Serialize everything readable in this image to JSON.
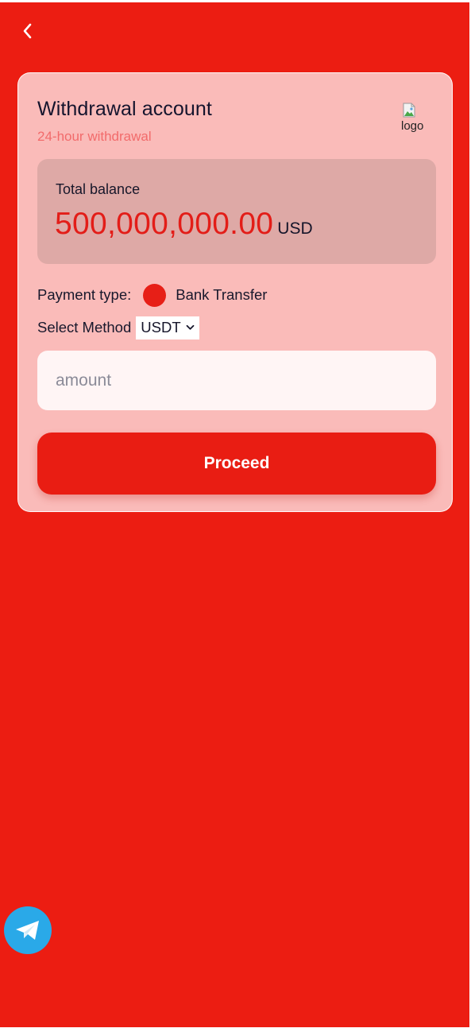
{
  "header": {
    "back_icon": "chevron-left-icon"
  },
  "card": {
    "title": "Withdrawal account",
    "subtitle": "24-hour withdrawal",
    "logo_alt": "logo"
  },
  "balance": {
    "label": "Total balance",
    "value": "500,000,000.00",
    "currency": "USD"
  },
  "payment": {
    "label": "Payment type:",
    "option": "Bank Transfer",
    "selected": true
  },
  "method": {
    "label": "Select Method",
    "selected": "USDT"
  },
  "amount": {
    "placeholder": "amount",
    "value": ""
  },
  "actions": {
    "proceed_label": "Proceed"
  },
  "floating": {
    "telegram_icon": "telegram-icon"
  },
  "colors": {
    "background": "#ec1d12",
    "card": "#fabbb9",
    "accent": "#e91d13",
    "subtitle": "#f26b6b",
    "balance_box": "#dea9a6",
    "telegram": "#2aa9e8"
  }
}
